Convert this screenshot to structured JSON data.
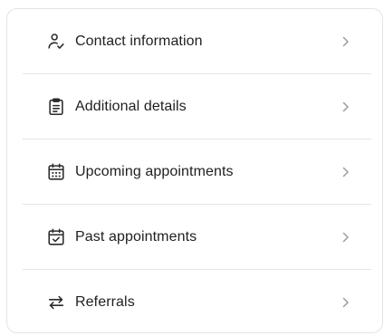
{
  "menu": {
    "items": [
      {
        "label": "Contact information",
        "icon": "user-check-icon"
      },
      {
        "label": "Additional details",
        "icon": "clipboard-list-icon"
      },
      {
        "label": "Upcoming appointments",
        "icon": "calendar-grid-icon"
      },
      {
        "label": "Past appointments",
        "icon": "calendar-check-icon"
      },
      {
        "label": "Referrals",
        "icon": "arrows-left-right-icon"
      }
    ],
    "chevron_icon": "chevron-right-icon"
  },
  "colors": {
    "text": "#1f1f23",
    "icon": "#2b2b2e",
    "chevron": "#9a9aa0",
    "divider": "#e5e5e8",
    "border": "#e3e3e6"
  }
}
